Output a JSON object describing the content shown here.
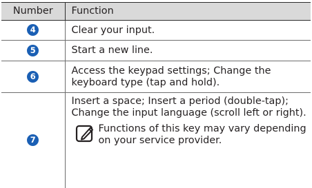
{
  "table": {
    "header": {
      "number": "Number",
      "function": "Function"
    },
    "rows": [
      {
        "number": "4",
        "function": "Clear your input."
      },
      {
        "number": "5",
        "function": "Start a new line."
      },
      {
        "number": "6",
        "function": "Access the keypad settings; Change the keyboard type (tap and hold)."
      },
      {
        "number": "7",
        "function": "Insert a space; Insert a period (double-tap); Change the input language (scroll left or right)."
      }
    ],
    "note": {
      "icon": "note-pencil-icon",
      "text": "Functions of this key may vary depending on your service provider."
    }
  },
  "colors": {
    "header_bg": "#d9d9d9",
    "badge": "#1a5fb4",
    "text": "#231f20"
  }
}
